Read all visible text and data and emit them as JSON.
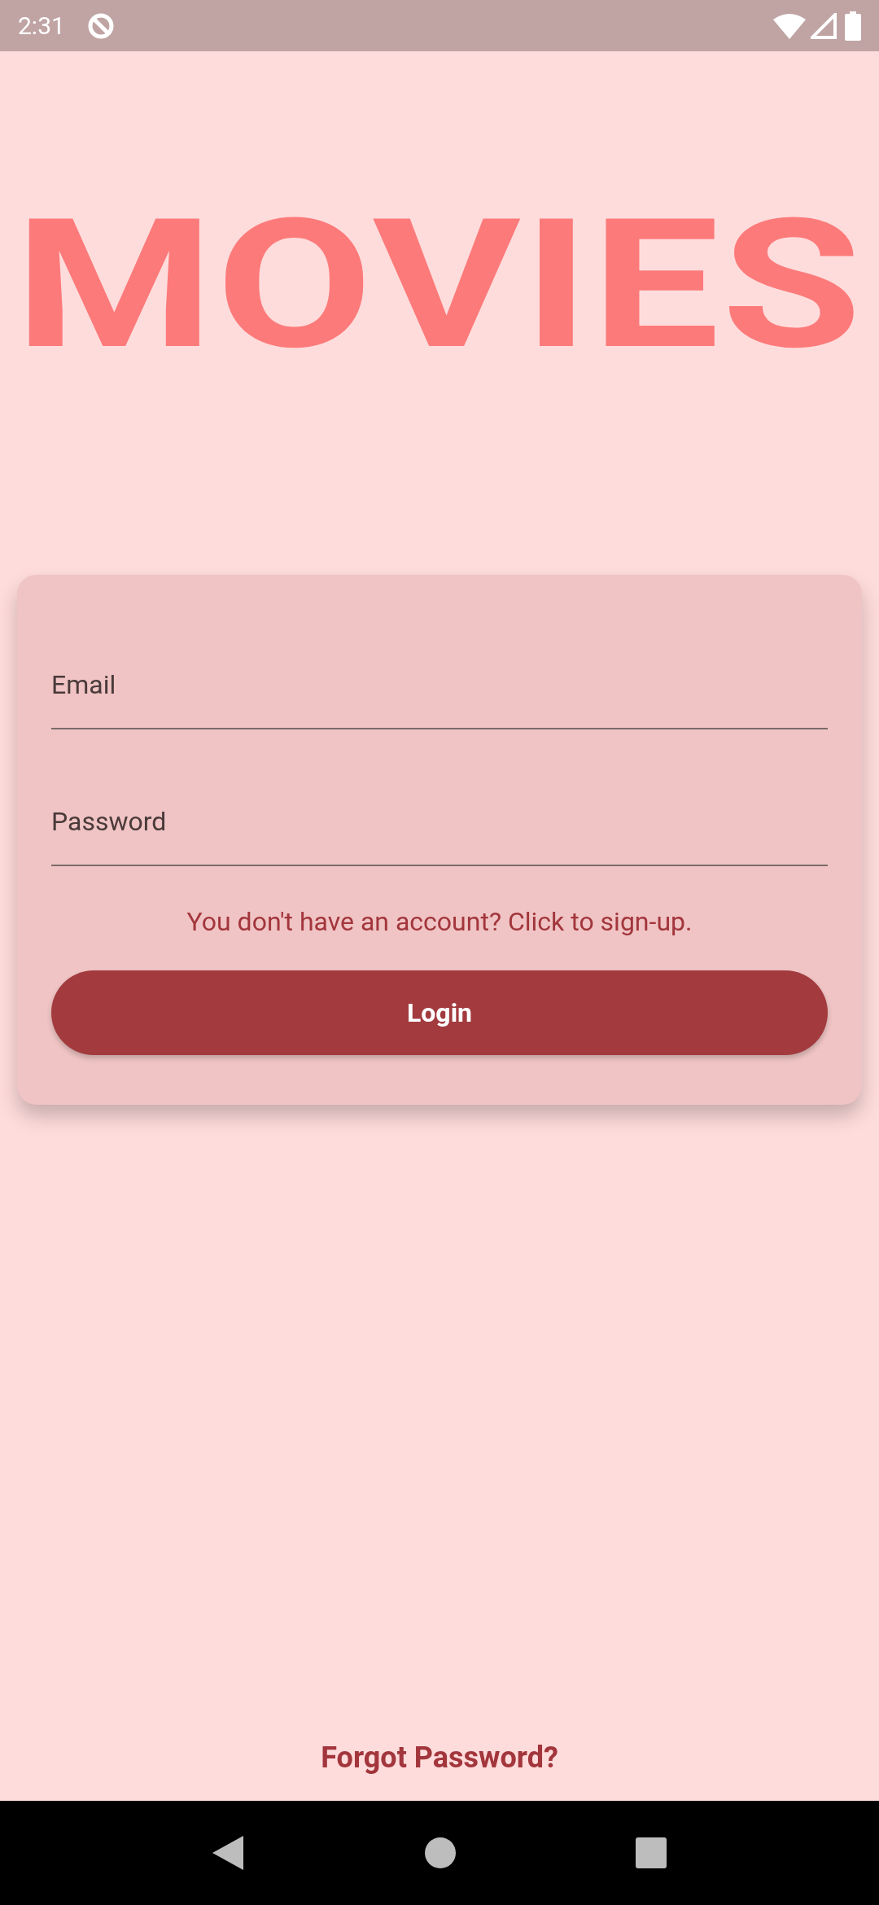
{
  "status_bar": {
    "time": "2:31"
  },
  "logo": "MOVIES",
  "login_form": {
    "fields": [
      {
        "placeholder": "Email"
      },
      {
        "placeholder": "Password"
      }
    ],
    "signup_link": "You don't have an account? Click to sign-up.",
    "login_button": "Login"
  },
  "forgot_password": "Forgot Password?"
}
